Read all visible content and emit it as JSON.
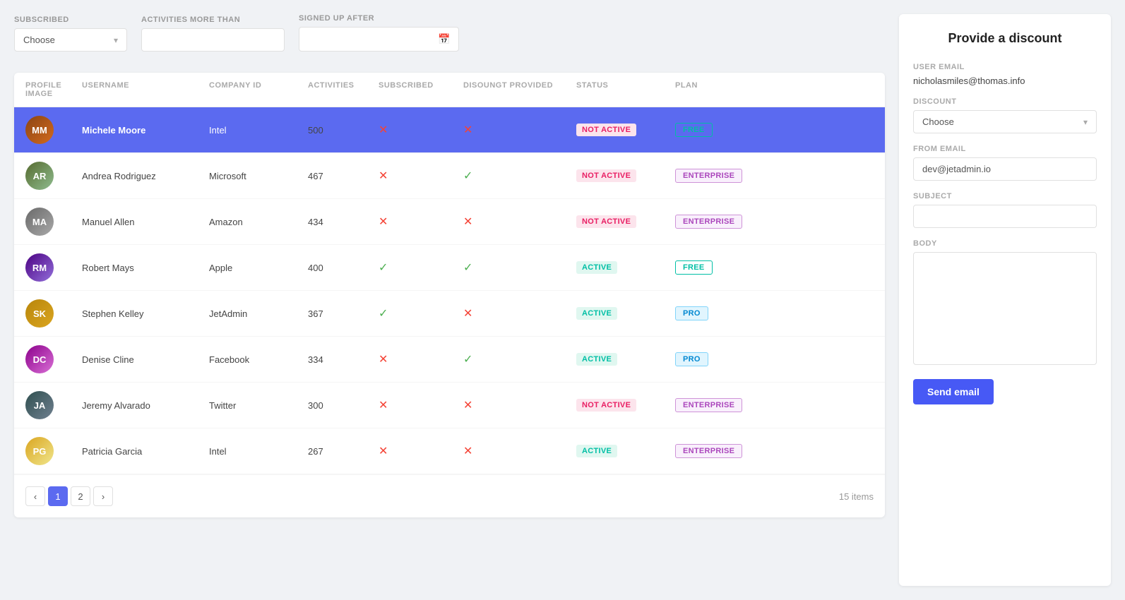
{
  "filters": {
    "subscribed_label": "SUBSCRIBED",
    "subscribed_placeholder": "Choose",
    "activities_label": "ACTIVITIES MORE THAN",
    "signed_up_label": "SIGNED UP AFTER"
  },
  "table": {
    "columns": [
      "PROFILE IMAGE",
      "USERNAME",
      "COMPANY ID",
      "ACTIVITIES",
      "SUBSCRIBED",
      "DISOUNGT PROVIDED",
      "STATUS",
      "PLAN"
    ],
    "rows": [
      {
        "id": 1,
        "username": "Michele Moore",
        "company": "Intel",
        "activities": "500",
        "subscribed": false,
        "discount_provided": false,
        "status": "NOT ACTIVE",
        "status_type": "not-active",
        "plan": "FREE",
        "plan_type": "free",
        "selected": true,
        "avatar_class": "av-1",
        "avatar_initials": "MM"
      },
      {
        "id": 2,
        "username": "Andrea Rodriguez",
        "company": "Microsoft",
        "activities": "467",
        "subscribed": false,
        "discount_provided": true,
        "status": "NOT ACTIVE",
        "status_type": "not-active",
        "plan": "ENTERPRISE",
        "plan_type": "enterprise",
        "selected": false,
        "avatar_class": "av-2",
        "avatar_initials": "AR"
      },
      {
        "id": 3,
        "username": "Manuel Allen",
        "company": "Amazon",
        "activities": "434",
        "subscribed": false,
        "discount_provided": false,
        "status": "NOT ACTIVE",
        "status_type": "not-active",
        "plan": "ENTERPRISE",
        "plan_type": "enterprise",
        "selected": false,
        "avatar_class": "av-3",
        "avatar_initials": "MA"
      },
      {
        "id": 4,
        "username": "Robert Mays",
        "company": "Apple",
        "activities": "400",
        "subscribed": true,
        "discount_provided": true,
        "status": "ACTIVE",
        "status_type": "active",
        "plan": "FREE",
        "plan_type": "free",
        "selected": false,
        "avatar_class": "av-4",
        "avatar_initials": "RM"
      },
      {
        "id": 5,
        "username": "Stephen Kelley",
        "company": "JetAdmin",
        "activities": "367",
        "subscribed": true,
        "discount_provided": false,
        "status": "ACTIVE",
        "status_type": "active",
        "plan": "PRO",
        "plan_type": "pro",
        "selected": false,
        "avatar_class": "av-5",
        "avatar_initials": "SK"
      },
      {
        "id": 6,
        "username": "Denise Cline",
        "company": "Facebook",
        "activities": "334",
        "subscribed": false,
        "discount_provided": true,
        "status": "ACTIVE",
        "status_type": "active",
        "plan": "PRO",
        "plan_type": "pro",
        "selected": false,
        "avatar_class": "av-6",
        "avatar_initials": "DC"
      },
      {
        "id": 7,
        "username": "Jeremy Alvarado",
        "company": "Twitter",
        "activities": "300",
        "subscribed": false,
        "discount_provided": false,
        "status": "NOT ACTIVE",
        "status_type": "not-active",
        "plan": "ENTERPRISE",
        "plan_type": "enterprise",
        "selected": false,
        "avatar_class": "av-7",
        "avatar_initials": "JA"
      },
      {
        "id": 8,
        "username": "Patricia Garcia",
        "company": "Intel",
        "activities": "267",
        "subscribed": false,
        "discount_provided": false,
        "status": "ACTIVE",
        "status_type": "active",
        "plan": "ENTERPRISE",
        "plan_type": "enterprise",
        "selected": false,
        "avatar_class": "av-8",
        "avatar_initials": "PG"
      }
    ]
  },
  "pagination": {
    "current_page": 1,
    "total_pages": 2,
    "items_count": "15 items"
  },
  "panel": {
    "title": "Provide a discount",
    "user_email_label": "USER EMAIL",
    "user_email_value": "nicholasmiles@thomas.info",
    "discount_label": "DISCOUNT",
    "discount_placeholder": "Choose",
    "from_email_label": "FROM EMAIL",
    "from_email_value": "dev@jetadmin.io",
    "subject_label": "SUBJECT",
    "subject_value": "",
    "body_label": "BODY",
    "body_value": "",
    "send_button_label": "Send email"
  }
}
